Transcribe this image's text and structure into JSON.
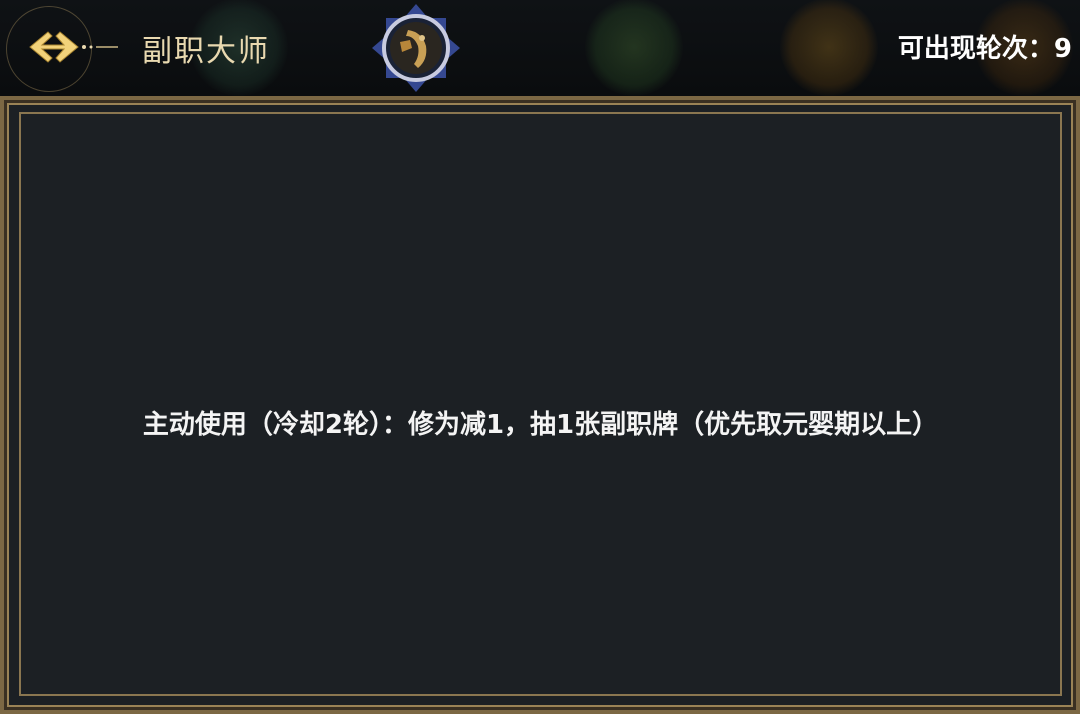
{
  "header": {
    "title": "副职大师",
    "rounds_text": "可出现轮次：9"
  },
  "icons": {
    "back": "back-arrow-icon",
    "emblem": "profession-emblem-icon"
  },
  "panel": {
    "description": "主动使用（冷却2轮）：修为减1，抽1张副职牌（优先取元婴期以上）"
  },
  "colors": {
    "accent_gold": "#e9d9b0",
    "panel_bg": "#1c2024",
    "frame_gold": "#8a7650",
    "text_white": "#f4f4f4"
  }
}
